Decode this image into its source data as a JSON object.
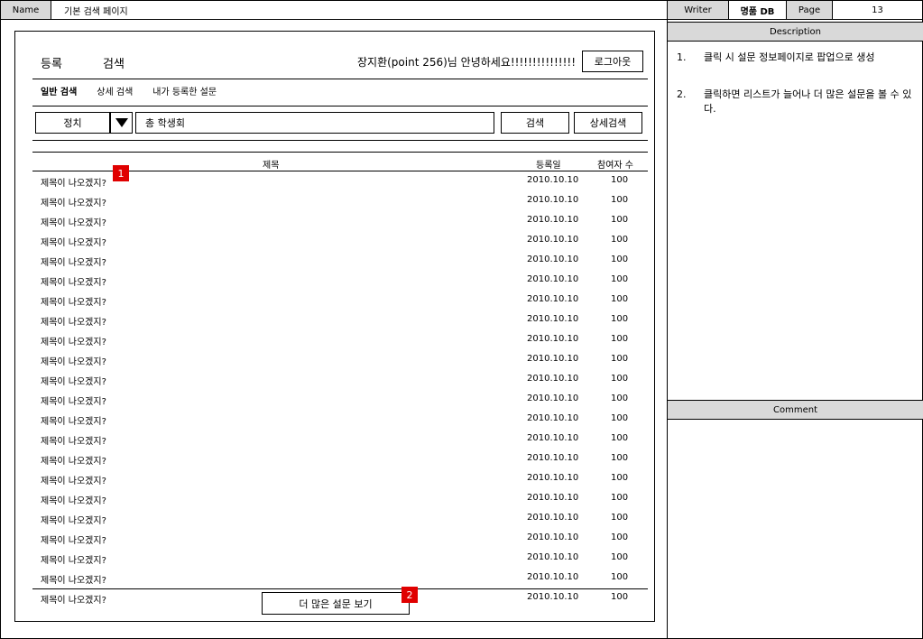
{
  "header": {
    "name_label": "Name",
    "name_value": "기본 검색 페이지",
    "writer_label": "Writer",
    "writer_value": "명품 DB",
    "page_label": "Page",
    "page_value": "13"
  },
  "nav": {
    "register": "등록",
    "search": "검색",
    "greeting": "장지환(point 256)님 안녕하세요!!!!!!!!!!!!!!!",
    "logout": "로그아웃"
  },
  "tabs": [
    "일반 검색",
    "상세 검색",
    "내가 등록한 설문"
  ],
  "search": {
    "category": "정치",
    "query": "총 학생회",
    "search_button": "검색",
    "detail_button": "상세검색"
  },
  "table": {
    "headers": {
      "title": "제목",
      "date": "등록일",
      "participants": "참여자 수"
    },
    "rows": [
      {
        "title": "제목이 나오겠지?",
        "date": "2010.10.10",
        "count": "100"
      },
      {
        "title": "제목이 나오겠지?",
        "date": "2010.10.10",
        "count": "100"
      },
      {
        "title": "제목이 나오겠지?",
        "date": "2010.10.10",
        "count": "100"
      },
      {
        "title": "제목이 나오겠지?",
        "date": "2010.10.10",
        "count": "100"
      },
      {
        "title": "제목이 나오겠지?",
        "date": "2010.10.10",
        "count": "100"
      },
      {
        "title": "제목이 나오겠지?",
        "date": "2010.10.10",
        "count": "100"
      },
      {
        "title": "제목이 나오겠지?",
        "date": "2010.10.10",
        "count": "100"
      },
      {
        "title": "제목이 나오겠지?",
        "date": "2010.10.10",
        "count": "100"
      },
      {
        "title": "제목이 나오겠지?",
        "date": "2010.10.10",
        "count": "100"
      },
      {
        "title": "제목이 나오겠지?",
        "date": "2010.10.10",
        "count": "100"
      },
      {
        "title": "제목이 나오겠지?",
        "date": "2010.10.10",
        "count": "100"
      },
      {
        "title": "제목이 나오겠지?",
        "date": "2010.10.10",
        "count": "100"
      },
      {
        "title": "제목이 나오겠지?",
        "date": "2010.10.10",
        "count": "100"
      },
      {
        "title": "제목이 나오겠지?",
        "date": "2010.10.10",
        "count": "100"
      },
      {
        "title": "제목이 나오겠지?",
        "date": "2010.10.10",
        "count": "100"
      },
      {
        "title": "제목이 나오겠지?",
        "date": "2010.10.10",
        "count": "100"
      },
      {
        "title": "제목이 나오겠지?",
        "date": "2010.10.10",
        "count": "100"
      },
      {
        "title": "제목이 나오겠지?",
        "date": "2010.10.10",
        "count": "100"
      },
      {
        "title": "제목이 나오겠지?",
        "date": "2010.10.10",
        "count": "100"
      },
      {
        "title": "제목이 나오겠지?",
        "date": "2010.10.10",
        "count": "100"
      },
      {
        "title": "제목이 나오겠지?",
        "date": "2010.10.10",
        "count": "100"
      },
      {
        "title": "제목이 나오겠지?",
        "date": "2010.10.10",
        "count": "100"
      }
    ]
  },
  "more_button": "더 많은 설문 보기",
  "markers": {
    "m1": "1",
    "m2": "2"
  },
  "description": {
    "title": "Description",
    "items": [
      {
        "num": "1.",
        "text": "클릭 시 설문 정보페이지로 팝업으로 생성"
      },
      {
        "num": "2.",
        "text": "클릭하면 리스트가 늘어나 더 많은 설문을 볼 수 있다."
      }
    ]
  },
  "comment": {
    "title": "Comment"
  },
  "colors": {
    "marker": "#e00000",
    "panel_header": "#d9d9d9"
  }
}
